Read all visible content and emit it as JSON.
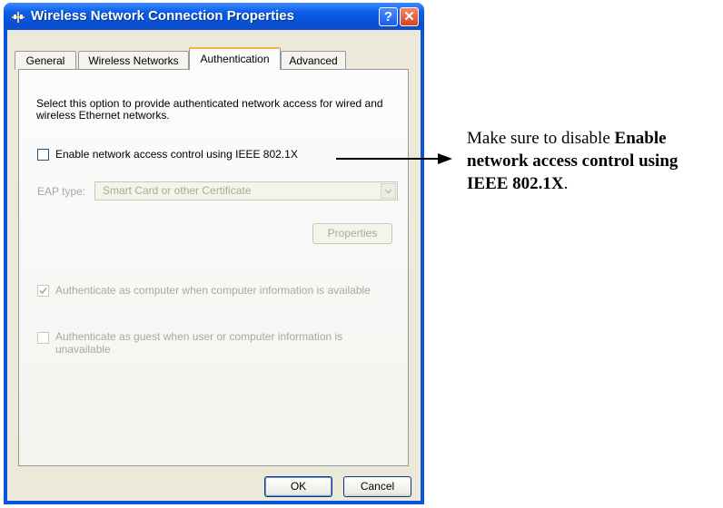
{
  "window": {
    "title": "Wireless Network Connection Properties",
    "help_label": "?",
    "close_label": "✕"
  },
  "tabs": [
    {
      "label": "General"
    },
    {
      "label": "Wireless Networks"
    },
    {
      "label": "Authentication",
      "active": true
    },
    {
      "label": "Advanced"
    }
  ],
  "authentication": {
    "description": "Select this option to provide authenticated network access for wired and wireless Ethernet networks.",
    "enable_8021x_label": "Enable network access control using IEEE 802.1X",
    "enable_8021x_checked": false,
    "eap_type_label": "EAP type:",
    "eap_type_value": "Smart Card or other Certificate",
    "properties_label": "Properties",
    "auth_computer_label": "Authenticate as computer when computer information is available",
    "auth_computer_checked": true,
    "auth_guest_label": "Authenticate as guest when user or computer information is unavailable",
    "auth_guest_checked": false
  },
  "footer": {
    "ok_label": "OK",
    "cancel_label": "Cancel"
  },
  "annotation": {
    "prefix": "Make sure to disable ",
    "bold": "Enable network access control using IEEE 802.1X",
    "suffix": "."
  },
  "colors": {
    "titlebar": "#0a55e0",
    "dialog_bg": "#ece9d8",
    "active_tab_highlight": "#f7b24a",
    "disabled_text": "#aca899"
  },
  "icons": [
    "network-connection-icon",
    "help-icon",
    "close-icon",
    "checkmark-icon",
    "chevron-down-icon",
    "arrow-right-icon"
  ]
}
